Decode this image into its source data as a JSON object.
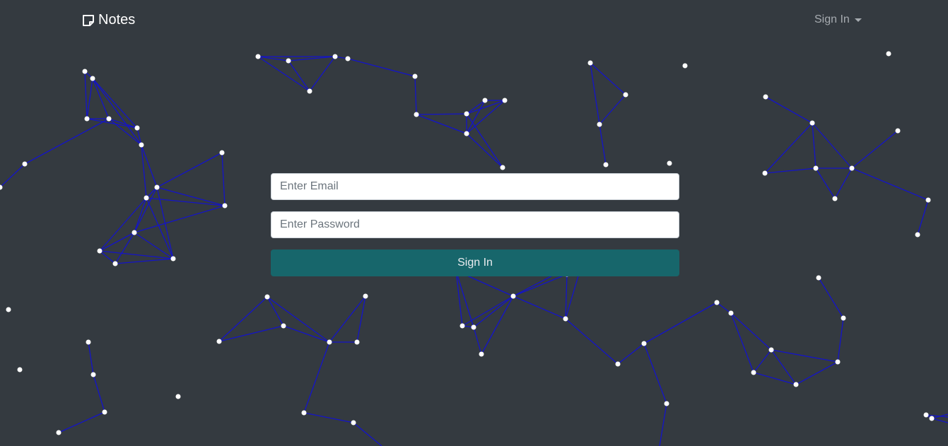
{
  "navbar": {
    "brand_label": "Notes",
    "brand_icon": "sticky-note-icon",
    "signin_menu_label": "Sign In",
    "signin_menu_icon": "caret-down-icon"
  },
  "signin_form": {
    "email_placeholder": "Enter Email",
    "email_value": "",
    "password_placeholder": "Enter Password",
    "password_value": "",
    "submit_label": "Sign In"
  },
  "colors": {
    "background": "#343a40",
    "particle": "#ffffff",
    "particle_link": "#1414c8",
    "button": "#17666b",
    "button_text": "#e9ecef"
  }
}
